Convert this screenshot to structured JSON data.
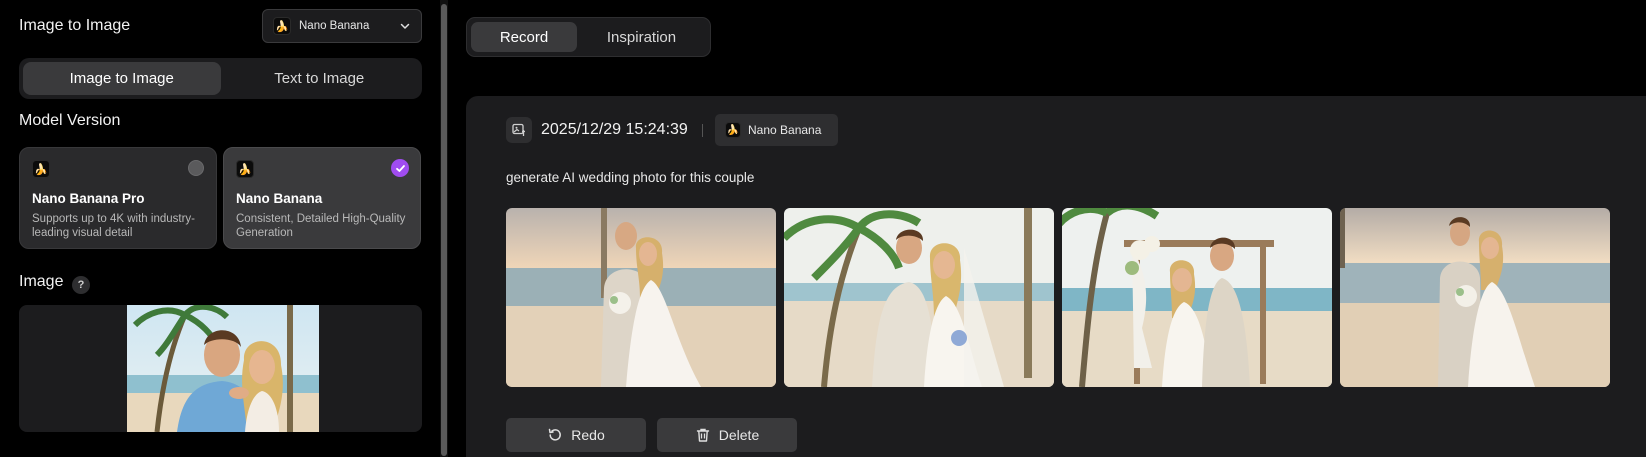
{
  "left": {
    "header_title": "Image to Image",
    "model_select": {
      "icon": "banana-icon",
      "value": "Nano Banana"
    },
    "mode_tabs": [
      {
        "label": "Image to Image",
        "active": true
      },
      {
        "label": "Text to Image",
        "active": false
      }
    ],
    "model_version": {
      "title": "Model Version",
      "options": [
        {
          "icon": "banana-icon",
          "name": "Nano Banana Pro",
          "description": "Supports up to 4K with industry-leading visual detail",
          "selected": false
        },
        {
          "icon": "banana-icon",
          "name": "Nano Banana",
          "description": "Consistent, Detailed High-Quality Generation",
          "selected": true
        }
      ]
    },
    "image_section": {
      "title": "Image",
      "help": "?"
    }
  },
  "right": {
    "tabs": [
      {
        "label": "Record",
        "active": true
      },
      {
        "label": "Inspiration",
        "active": false
      }
    ],
    "record": {
      "timestamp": "2025/12/29 15:24:39",
      "model_badge": "Nano Banana",
      "prompt": "generate AI wedding photo for this couple",
      "result_count": 4,
      "actions": {
        "redo": "Redo",
        "delete": "Delete"
      }
    }
  },
  "colors": {
    "background": "#000000",
    "panel": "#1c1c1e",
    "active_tab": "#3a3a3c",
    "check_purple": "#a04cf0",
    "banana_yellow": "#f5c518"
  }
}
